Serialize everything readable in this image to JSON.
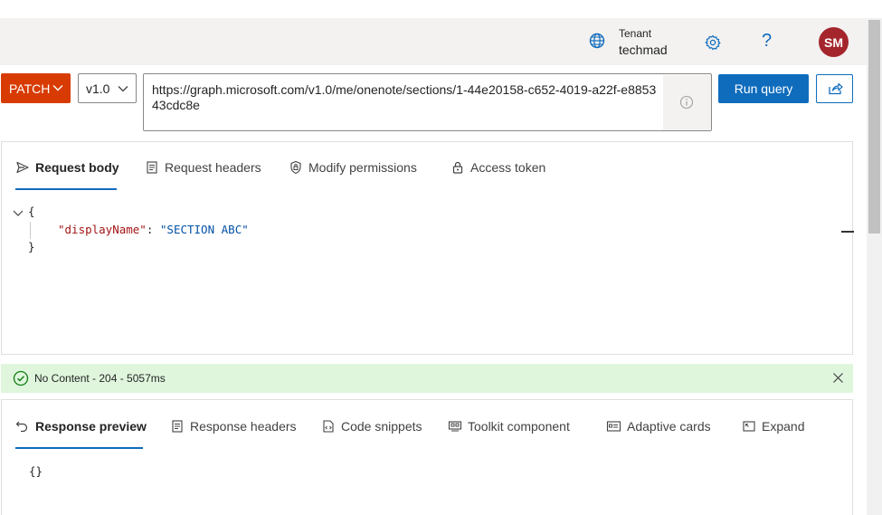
{
  "header": {
    "tenant_label": "Tenant",
    "tenant_name": "techmad",
    "help_glyph": "?",
    "avatar_initials": "SM",
    "icons": {
      "tenant": "globe-building-icon",
      "settings": "gear-icon",
      "help": "question-icon"
    }
  },
  "query": {
    "method": "PATCH",
    "version": "v1.0",
    "url": "https://graph.microsoft.com/v1.0/me/onenote/sections/1-44e20158-c652-4019-a22f-e885343cdc8e",
    "run_label": "Run query",
    "share_icon": "share-icon",
    "info_icon": "info-icon"
  },
  "request_tabs": [
    {
      "label": "Request body",
      "icon": "send-icon",
      "active": true
    },
    {
      "label": "Request headers",
      "icon": "document-icon",
      "active": false
    },
    {
      "label": "Modify permissions",
      "icon": "lock-shield-icon",
      "active": false
    },
    {
      "label": "Access token",
      "icon": "lock-icon",
      "active": false
    }
  ],
  "request_body": {
    "open_brace": "{",
    "key": "\"displayName\"",
    "colon": ": ",
    "value": "\"SECTION ABC\"",
    "close_brace": "}"
  },
  "status": {
    "text": "No Content - 204 - 5057ms",
    "icon": "check-circle-icon"
  },
  "response_tabs": [
    {
      "label": "Response preview",
      "icon": "undo-arrow-icon",
      "active": true
    },
    {
      "label": "Response headers",
      "icon": "document-icon",
      "active": false
    },
    {
      "label": "Code snippets",
      "icon": "code-document-icon",
      "active": false
    },
    {
      "label": "Toolkit component",
      "icon": "toolkit-icon",
      "active": false
    },
    {
      "label": "Adaptive cards",
      "icon": "card-icon",
      "active": false
    },
    {
      "label": "Expand",
      "icon": "expand-icon",
      "active": false
    }
  ],
  "response_body": "{}",
  "colors": {
    "method_bg": "#d83b01",
    "accent": "#0f6cbd",
    "success_bg": "#dff6dd",
    "success_icon": "#107c10",
    "avatar_bg": "#a4262c"
  }
}
